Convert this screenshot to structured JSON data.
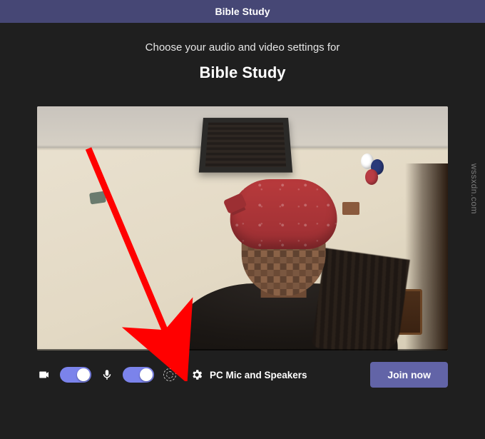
{
  "titlebar": {
    "title": "Bible Study"
  },
  "prejoin": {
    "heading": "Choose your audio and video settings for",
    "meeting_name": "Bible Study"
  },
  "controls": {
    "camera_on": true,
    "mic_on": true,
    "device_label": "PC Mic and Speakers",
    "join_label": "Join now"
  },
  "icons": {
    "camera": "camera-icon",
    "mic": "mic-icon",
    "background_blur": "background-blur-icon",
    "settings": "gear-icon"
  },
  "colors": {
    "accent": "#6264a7",
    "toggle_on": "#7b83eb",
    "titlebar": "#464775",
    "annotation_arrow": "#ff0000"
  },
  "watermark": "wssxdn.com"
}
